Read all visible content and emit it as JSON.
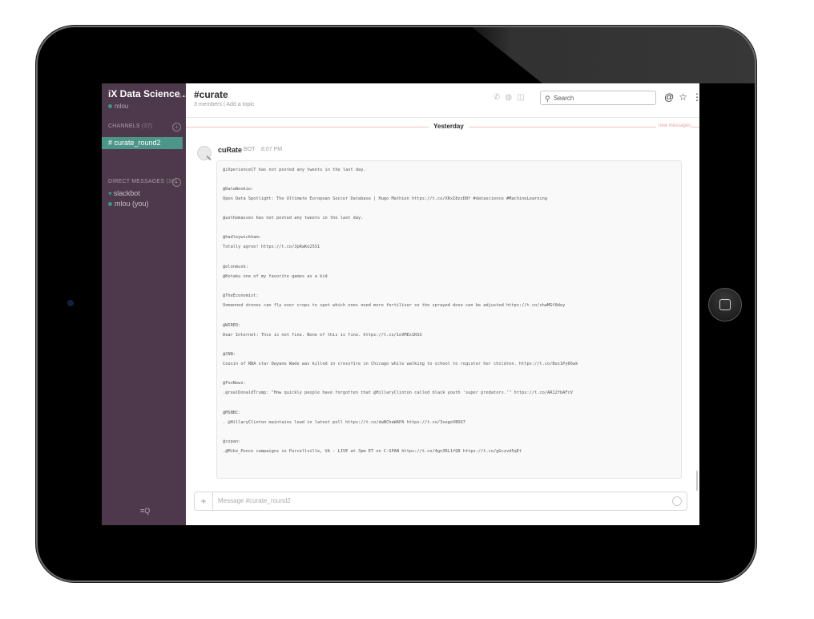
{
  "sidebar": {
    "team_name": "iX Data Science ...",
    "team_caret": "⌄",
    "user_status": "mlou",
    "channels_label": "CHANNELS",
    "channels_count": "(37)",
    "active_channel": "# curate_round2",
    "dm_label": "DIRECT MESSAGES",
    "dm_count": "(38)",
    "dms": [
      {
        "name": "slackbot"
      },
      {
        "name": "mlou (you)"
      }
    ],
    "bottom_icon": "search-filter-icon"
  },
  "header": {
    "channel_title": "#curate",
    "members": "3 members",
    "separator": "|",
    "add_topic": "Add a topic",
    "search_placeholder": "Search"
  },
  "messages": {
    "day_label": "Yesterday",
    "new_label": "new messages",
    "author": "cuRate",
    "bot_badge": "BOT",
    "time": "8:07 PM",
    "lines": [
      "@iXperienceCT has not posted any tweets in the last day.",
      "@DataWookie:",
      "Open Data Spotlight: The Ultimate European Soccer Database | Hugo Mathien https://t.co/XRxI8zzD8f #datascience #MachineLearning",
      "@usthemasses has not posted any tweets in the last day.",
      "@hadleywickham:",
      "Totally agree! https://t.co/3pRaKe25S1",
      "@elonmusk:",
      "@Kotaku one of my favorite games as a kid",
      "@TheEconomist:",
      "Unmanned drones can fly over crops to spot which ones need more fertiliser so the sprayed dose can be adjusted https://t.co/shwMGf8dey",
      "@WIRED:",
      "Dear Internet: This is not fine. None of this is fine. https://t.co/1oVMEx1RSS",
      "@CNN:",
      "Cousin of NBA star Dwyane Wade was killed in crossfire in Chicago while walking to school to register her children. https://t.co/Bes1Py66ak",
      "@FoxNews:",
      ".@realDonaldTrump: \"How quickly people have forgotten that @HillaryClinton called black youth 'super predators.'\" https://t.co/AR12fbAFcV",
      "@MSNBC:",
      ". @HillaryClinton maintains lead in latest poll https://t.co/dwBChaWAPA https://t.co/3xegeVBOX7",
      "@cspan:",
      ".@Mike_Pence campaigns in Purcellville, VA - LIVE at 3pm ET on C-SPAN https://t.co/4gn3RL1fQ8 https://t.co/gGczvd5qEt"
    ]
  },
  "composer": {
    "placeholder": "Message #curate_round2"
  },
  "colors": {
    "sidebar_bg": "#4d394b",
    "active_channel_bg": "#4c9689",
    "presence_green": "#38978d",
    "divider_red": "#f3c2c2"
  }
}
